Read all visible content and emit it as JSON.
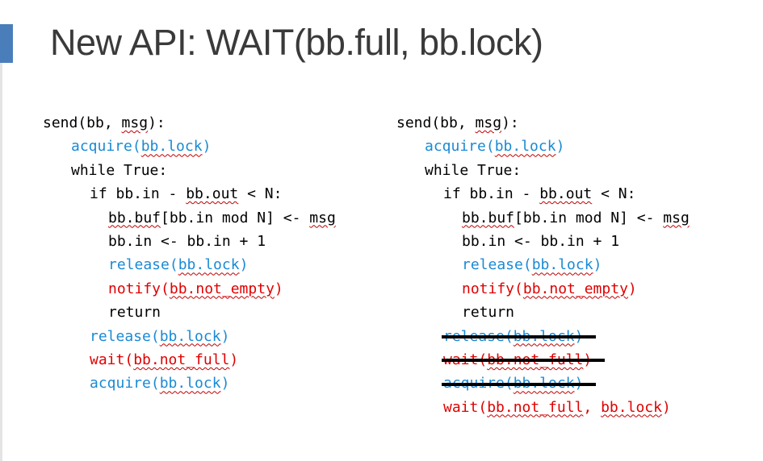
{
  "slide": {
    "title": "New API: WAIT(bb.full, bb.lock)",
    "accent_color": "#4a7ebb"
  },
  "left_code": [
    {
      "text": "send(bb, msg):",
      "color": "black",
      "indent": 0
    },
    {
      "text": "acquire(bb.lock)",
      "color": "blue",
      "indent": 1
    },
    {
      "text": "while True:",
      "color": "black",
      "indent": 1
    },
    {
      "text": "if bb.in - bb.out < N:",
      "color": "black",
      "indent": 2
    },
    {
      "text": "bb.buf[bb.in mod N] <- msg",
      "color": "black",
      "indent": 3
    },
    {
      "text": "bb.in <- bb.in + 1",
      "color": "black",
      "indent": 3
    },
    {
      "text": "release(bb.lock)",
      "color": "blue",
      "indent": 3
    },
    {
      "text": "notify(bb.not_empty)",
      "color": "red",
      "indent": 3
    },
    {
      "text": "return",
      "color": "black",
      "indent": 3
    },
    {
      "text": "release(bb.lock)",
      "color": "blue",
      "indent": 2
    },
    {
      "text": "wait(bb.not_full)",
      "color": "red",
      "indent": 2
    },
    {
      "text": "acquire(bb.lock)",
      "color": "blue",
      "indent": 2
    }
  ],
  "right_code": [
    {
      "text": "send(bb, msg):",
      "color": "black",
      "indent": 0
    },
    {
      "text": "acquire(bb.lock)",
      "color": "blue",
      "indent": 1
    },
    {
      "text": "while True:",
      "color": "black",
      "indent": 1
    },
    {
      "text": "if bb.in - bb.out < N:",
      "color": "black",
      "indent": 2
    },
    {
      "text": "bb.buf[bb.in mod N] <- msg",
      "color": "black",
      "indent": 3
    },
    {
      "text": "bb.in <- bb.in + 1",
      "color": "black",
      "indent": 3
    },
    {
      "text": "release(bb.lock)",
      "color": "blue",
      "indent": 3
    },
    {
      "text": "notify(bb.not_empty)",
      "color": "red",
      "indent": 3
    },
    {
      "text": "return",
      "color": "black",
      "indent": 3
    },
    {
      "text": "release(bb.lock)",
      "color": "blue",
      "indent": 2,
      "struck": true
    },
    {
      "text": "wait(bb.not_full)",
      "color": "red",
      "indent": 2,
      "struck": true
    },
    {
      "text": "acquire(bb.lock)",
      "color": "blue",
      "indent": 2,
      "struck": true
    },
    {
      "text": "wait(bb.not_full, bb.lock)",
      "color": "red",
      "indent": 2
    }
  ],
  "colors": {
    "blue": "#1a8ad4",
    "red": "#e00000",
    "black": "#000000",
    "title": "#3a3a3a"
  }
}
